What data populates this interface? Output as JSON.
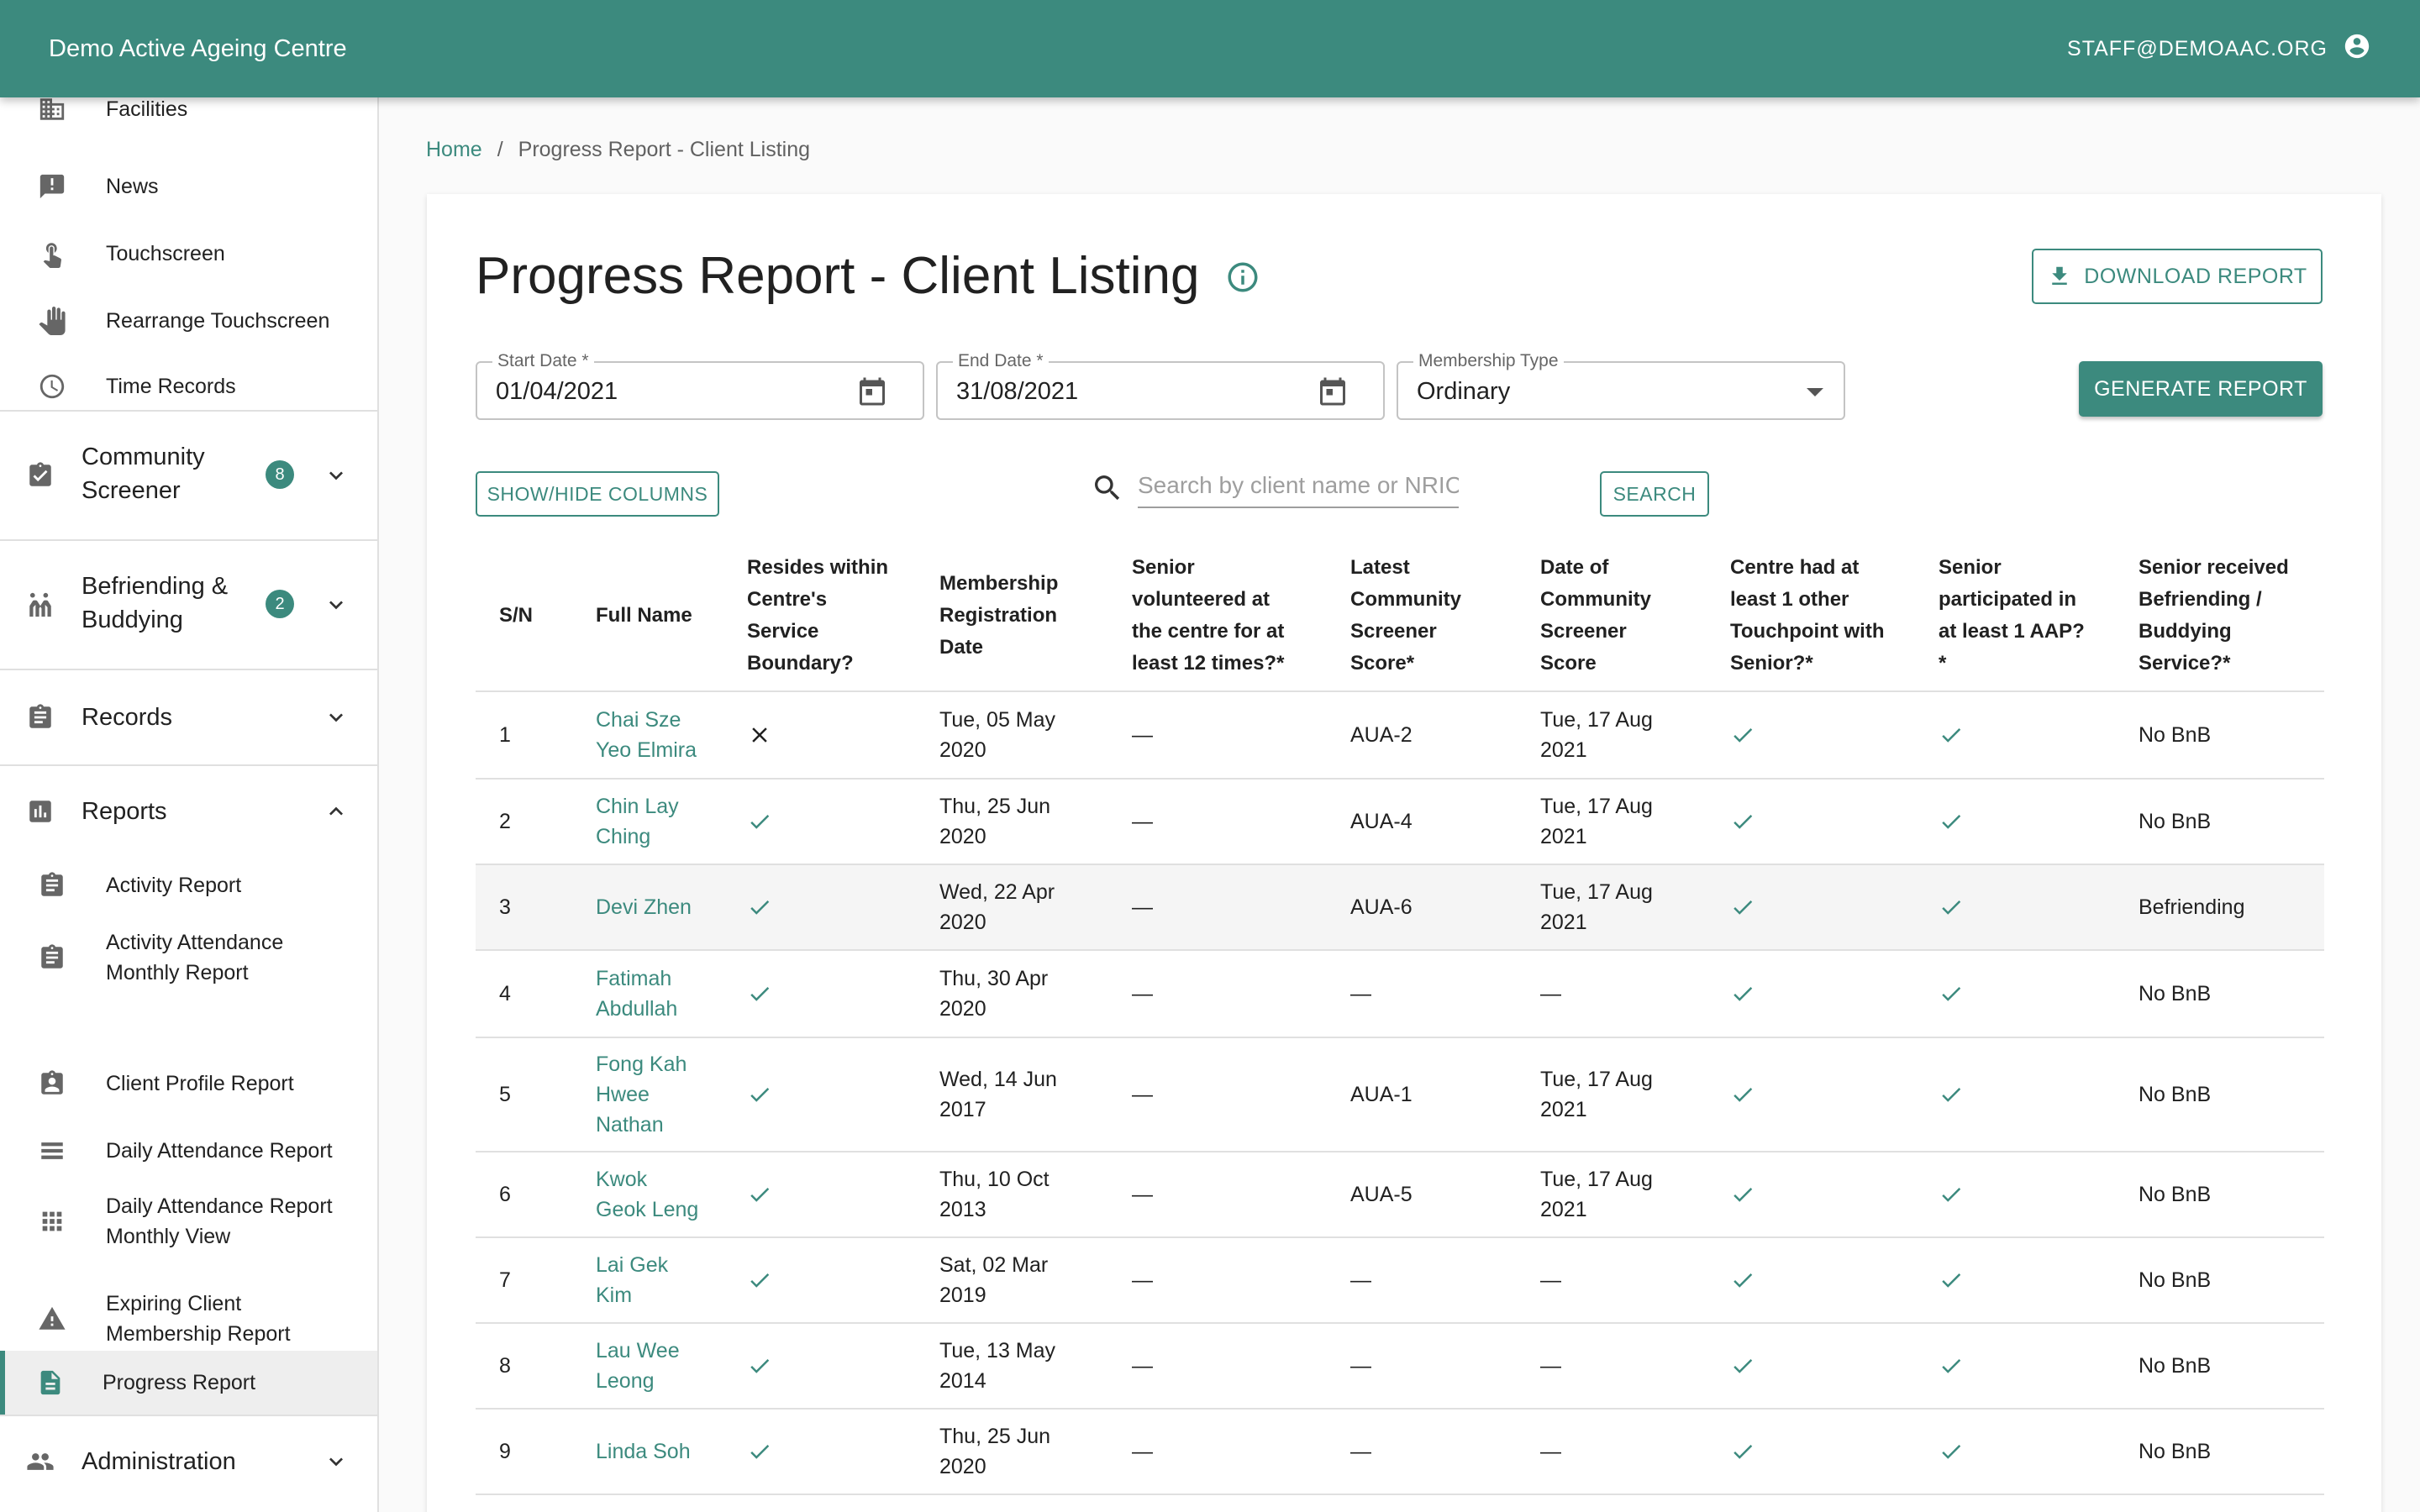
{
  "header": {
    "app_title": "Demo Active Ageing Centre",
    "user_email": "STAFF@DEMOAAC.ORG"
  },
  "sidebar": {
    "items": [
      {
        "label": "Facilities",
        "icon": "building-icon"
      },
      {
        "label": "News",
        "icon": "announcement-icon"
      },
      {
        "label": "Touchscreen",
        "icon": "touch-icon"
      },
      {
        "label": "Rearrange Touchscreen",
        "icon": "hand-icon"
      },
      {
        "label": "Time Records",
        "icon": "clock-icon"
      }
    ],
    "community_screener": {
      "label_line1": "Community",
      "label_line2": "Screener",
      "badge": "8"
    },
    "befriending": {
      "label_line1": "Befriending &",
      "label_line2": "Buddying",
      "badge": "2"
    },
    "records": {
      "label": "Records"
    },
    "reports": {
      "label": "Reports",
      "items": [
        {
          "label": "Activity Report"
        },
        {
          "label_line1": "Activity Attendance",
          "label_line2": "Monthly Report"
        },
        {
          "label": "Client Profile Report"
        },
        {
          "label": "Daily Attendance Report"
        },
        {
          "label_line1": "Daily Attendance Report",
          "label_line2": "Monthly View"
        },
        {
          "label_line1": "Expiring Client",
          "label_line2": "Membership Report"
        },
        {
          "label": "Progress Report"
        }
      ]
    },
    "administration": {
      "label": "Administration"
    }
  },
  "breadcrumb": {
    "home": "Home",
    "separator": "/",
    "current": "Progress Report - Client Listing"
  },
  "page": {
    "title": "Progress Report - Client Listing",
    "download_label": "DOWNLOAD REPORT",
    "generate_label": "GENERATE REPORT",
    "show_hide_label": "SHOW/HIDE COLUMNS",
    "search_label": "SEARCH",
    "search_placeholder": "Search by client name or NRIC..."
  },
  "filters": {
    "start_date": {
      "label": "Start Date *",
      "value": "01/04/2021"
    },
    "end_date": {
      "label": "End Date *",
      "value": "31/08/2021"
    },
    "membership_type": {
      "label": "Membership Type",
      "value": "Ordinary"
    }
  },
  "table": {
    "headers": {
      "sn": "S/N",
      "name": "Full Name",
      "resides": [
        "Resides within",
        "Centre's",
        "Service",
        "Boundary?"
      ],
      "reg": [
        "Membership",
        "Registration",
        "Date"
      ],
      "volunteer": [
        "Senior",
        "volunteered at",
        "the centre for at",
        "least 12 times?*"
      ],
      "score": [
        "Latest",
        "Community",
        "Screener",
        "Score*"
      ],
      "date_score": [
        "Date of",
        "Community",
        "Screener",
        "Score"
      ],
      "touchpoint": [
        "Centre had at",
        "least 1 other",
        "Touchpoint with",
        "Senior?*"
      ],
      "aap": [
        "Senior",
        "participated in",
        "at least 1 AAP?",
        "*"
      ],
      "bnb": [
        "Senior received",
        "Befriending /",
        "Buddying",
        "Service?*"
      ]
    },
    "rows": [
      {
        "sn": "1",
        "name": [
          "Chai Sze",
          "Yeo Elmira"
        ],
        "resides": "cross",
        "reg": [
          "Tue, 05 May",
          "2020"
        ],
        "volunteer": "—",
        "score": "AUA-2",
        "date": [
          "Tue, 17 Aug",
          "2021"
        ],
        "touch": "check",
        "aap": "check",
        "bnb": "No BnB"
      },
      {
        "sn": "2",
        "name": [
          "Chin Lay",
          "Ching"
        ],
        "resides": "check",
        "reg": [
          "Thu, 25 Jun",
          "2020"
        ],
        "volunteer": "—",
        "score": "AUA-4",
        "date": [
          "Tue, 17 Aug",
          "2021"
        ],
        "touch": "check",
        "aap": "check",
        "bnb": "No BnB"
      },
      {
        "sn": "3",
        "name": [
          "Devi Zhen"
        ],
        "resides": "check",
        "reg": [
          "Wed, 22 Apr",
          "2020"
        ],
        "volunteer": "—",
        "score": "AUA-6",
        "date": [
          "Tue, 17 Aug",
          "2021"
        ],
        "touch": "check",
        "aap": "check",
        "bnb": "Befriending"
      },
      {
        "sn": "4",
        "name": [
          "Fatimah",
          "Abdullah"
        ],
        "resides": "check",
        "reg": [
          "Thu, 30 Apr",
          "2020"
        ],
        "volunteer": "—",
        "score": "—",
        "date": [
          "—"
        ],
        "touch": "check",
        "aap": "check",
        "bnb": "No BnB"
      },
      {
        "sn": "5",
        "name": [
          "Fong Kah",
          "Hwee",
          "Nathan"
        ],
        "resides": "check",
        "reg": [
          "Wed, 14 Jun",
          "2017"
        ],
        "volunteer": "—",
        "score": "AUA-1",
        "date": [
          "Tue, 17 Aug",
          "2021"
        ],
        "touch": "check",
        "aap": "check",
        "bnb": "No BnB"
      },
      {
        "sn": "6",
        "name": [
          "Kwok",
          "Geok Leng"
        ],
        "resides": "check",
        "reg": [
          "Thu, 10 Oct",
          "2013"
        ],
        "volunteer": "—",
        "score": "AUA-5",
        "date": [
          "Tue, 17 Aug",
          "2021"
        ],
        "touch": "check",
        "aap": "check",
        "bnb": "No BnB"
      },
      {
        "sn": "7",
        "name": [
          "Lai Gek",
          "Kim"
        ],
        "resides": "check",
        "reg": [
          "Sat, 02 Mar",
          "2019"
        ],
        "volunteer": "—",
        "score": "—",
        "date": [
          "—"
        ],
        "touch": "check",
        "aap": "check",
        "bnb": "No BnB"
      },
      {
        "sn": "8",
        "name": [
          "Lau Wee",
          "Leong"
        ],
        "resides": "check",
        "reg": [
          "Tue, 13 May",
          "2014"
        ],
        "volunteer": "—",
        "score": "—",
        "date": [
          "—"
        ],
        "touch": "check",
        "aap": "check",
        "bnb": "No BnB"
      },
      {
        "sn": "9",
        "name": [
          "Linda Soh"
        ],
        "resides": "check",
        "reg": [
          "Thu, 25 Jun",
          "2020"
        ],
        "volunteer": "—",
        "score": "—",
        "date": [
          "—"
        ],
        "touch": "check",
        "aap": "check",
        "bnb": "No BnB"
      }
    ]
  },
  "colors": {
    "primary": "#3c8a7e"
  }
}
